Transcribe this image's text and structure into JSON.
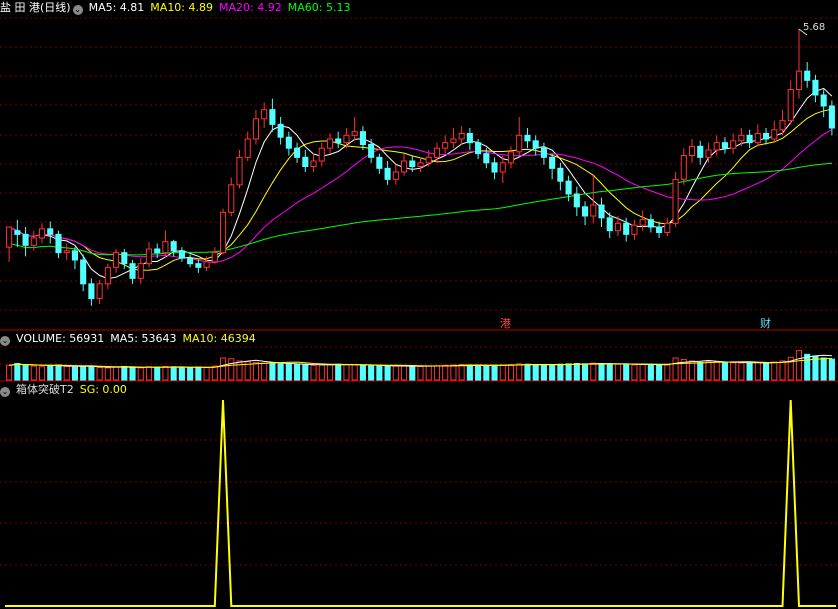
{
  "price_legend": {
    "title": "盐 田 港(日线)",
    "ma5": "MA5: 4.81",
    "ma10": "MA10: 4.89",
    "ma20": "MA20: 4.92",
    "ma60": "MA60: 5.13"
  },
  "volume_legend": {
    "title": "VOLUME: 56931",
    "ma5": "MA5: 53643",
    "ma10": "MA10: 46394"
  },
  "indicator_legend": {
    "title": "箱体突破T2",
    "sg": "SG: 0.00"
  },
  "markers": {
    "gang": "港",
    "cai": "财",
    "high_value": "5.68"
  },
  "colors": {
    "up": "#ff3232",
    "down": "#54ffff",
    "ma5": "#ffffff",
    "ma10": "#ffff00",
    "ma20": "#ff00ff",
    "ma60": "#00ff00",
    "sg": "#ffff00",
    "grid": "#7a0000",
    "divider": "#b40000"
  },
  "chart_data": {
    "type": "candlestick",
    "highest_label": 5.68,
    "sg_signal_bar_indices": [
      26,
      95
    ],
    "ohlc": [
      [
        4.49,
        4.6,
        4.58,
        4.41
      ],
      [
        4.58,
        4.56,
        4.64,
        4.49
      ],
      [
        4.56,
        4.5,
        4.6,
        4.44
      ],
      [
        4.5,
        4.54,
        4.58,
        4.47
      ],
      [
        4.54,
        4.59,
        4.62,
        4.51
      ],
      [
        4.59,
        4.56,
        4.63,
        4.51
      ],
      [
        4.56,
        4.46,
        4.58,
        4.43
      ],
      [
        4.46,
        4.47,
        4.51,
        4.42
      ],
      [
        4.47,
        4.42,
        4.49,
        4.37
      ],
      [
        4.42,
        4.29,
        4.45,
        4.25
      ],
      [
        4.29,
        4.21,
        4.32,
        4.17
      ],
      [
        4.21,
        4.29,
        4.31,
        4.18
      ],
      [
        4.29,
        4.38,
        4.4,
        4.26
      ],
      [
        4.38,
        4.46,
        4.48,
        4.35
      ],
      [
        4.46,
        4.4,
        4.48,
        4.37
      ],
      [
        4.4,
        4.32,
        4.42,
        4.29
      ],
      [
        4.32,
        4.4,
        4.43,
        4.29
      ],
      [
        4.4,
        4.48,
        4.52,
        4.38
      ],
      [
        4.48,
        4.46,
        4.51,
        4.43
      ],
      [
        4.46,
        4.52,
        4.58,
        4.43
      ],
      [
        4.52,
        4.47,
        4.53,
        4.44
      ],
      [
        4.47,
        4.43,
        4.49,
        4.41
      ],
      [
        4.43,
        4.4,
        4.45,
        4.38
      ],
      [
        4.4,
        4.38,
        4.42,
        4.35
      ],
      [
        4.38,
        4.41,
        4.44,
        4.36
      ],
      [
        4.41,
        4.46,
        4.49,
        4.4
      ],
      [
        4.46,
        4.68,
        4.7,
        4.45
      ],
      [
        4.68,
        4.83,
        4.87,
        4.66
      ],
      [
        4.83,
        4.98,
        5.02,
        4.81
      ],
      [
        4.98,
        5.08,
        5.12,
        4.96
      ],
      [
        5.08,
        5.19,
        5.24,
        5.05
      ],
      [
        5.19,
        5.24,
        5.28,
        5.14
      ],
      [
        5.24,
        5.16,
        5.3,
        5.12
      ],
      [
        5.16,
        5.09,
        5.2,
        5.05
      ],
      [
        5.09,
        5.03,
        5.12,
        4.99
      ],
      [
        5.03,
        4.98,
        5.06,
        4.95
      ],
      [
        4.98,
        4.93,
        5.02,
        4.9
      ],
      [
        4.93,
        4.96,
        5.0,
        4.9
      ],
      [
        4.96,
        5.03,
        5.06,
        4.93
      ],
      [
        5.03,
        5.08,
        5.11,
        5.0
      ],
      [
        5.08,
        5.06,
        5.12,
        5.03
      ],
      [
        5.06,
        5.1,
        5.14,
        5.03
      ],
      [
        5.1,
        5.12,
        5.2,
        5.07
      ],
      [
        5.12,
        5.05,
        5.15,
        5.02
      ],
      [
        5.05,
        4.98,
        5.08,
        4.95
      ],
      [
        4.98,
        4.92,
        5.0,
        4.89
      ],
      [
        4.92,
        4.86,
        4.96,
        4.83
      ],
      [
        4.86,
        4.9,
        4.94,
        4.83
      ],
      [
        4.9,
        4.96,
        5.0,
        4.88
      ],
      [
        4.96,
        4.93,
        4.99,
        4.9
      ],
      [
        4.93,
        4.95,
        4.98,
        4.9
      ],
      [
        4.95,
        4.98,
        5.02,
        4.93
      ],
      [
        4.98,
        5.03,
        5.06,
        4.95
      ],
      [
        5.03,
        5.06,
        5.1,
        5.0
      ],
      [
        5.06,
        5.08,
        5.14,
        5.03
      ],
      [
        5.08,
        5.11,
        5.15,
        5.05
      ],
      [
        5.11,
        5.06,
        5.14,
        5.02
      ],
      [
        5.06,
        5.0,
        5.08,
        4.97
      ],
      [
        5.0,
        4.95,
        5.03,
        4.92
      ],
      [
        4.95,
        4.9,
        4.98,
        4.86
      ],
      [
        4.9,
        4.95,
        4.99,
        4.84
      ],
      [
        4.95,
        5.01,
        5.04,
        4.92
      ],
      [
        5.01,
        5.1,
        5.2,
        4.99
      ],
      [
        5.1,
        5.07,
        5.14,
        5.03
      ],
      [
        5.07,
        5.03,
        5.1,
        4.99
      ],
      [
        5.03,
        4.98,
        5.06,
        4.94
      ],
      [
        4.98,
        4.92,
        5.0,
        4.86
      ],
      [
        4.92,
        4.85,
        4.95,
        4.8
      ],
      [
        4.85,
        4.78,
        4.88,
        4.74
      ],
      [
        4.78,
        4.71,
        4.82,
        4.66
      ],
      [
        4.71,
        4.66,
        4.74,
        4.61
      ],
      [
        4.66,
        4.72,
        4.88,
        4.62
      ],
      [
        4.72,
        4.65,
        4.76,
        4.6
      ],
      [
        4.65,
        4.58,
        4.68,
        4.54
      ],
      [
        4.58,
        4.62,
        4.66,
        4.55
      ],
      [
        4.62,
        4.56,
        4.65,
        4.52
      ],
      [
        4.56,
        4.61,
        4.64,
        4.53
      ],
      [
        4.61,
        4.64,
        4.69,
        4.58
      ],
      [
        4.64,
        4.6,
        4.67,
        4.57
      ],
      [
        4.6,
        4.57,
        4.63,
        4.54
      ],
      [
        4.57,
        4.62,
        4.65,
        4.55
      ],
      [
        4.62,
        4.86,
        4.9,
        4.6
      ],
      [
        4.86,
        4.99,
        5.03,
        4.83
      ],
      [
        4.99,
        5.04,
        5.08,
        4.95
      ],
      [
        5.04,
        4.98,
        5.07,
        4.94
      ],
      [
        4.98,
        5.02,
        5.06,
        4.95
      ],
      [
        5.02,
        5.06,
        5.1,
        4.99
      ],
      [
        5.06,
        5.03,
        5.09,
        5.0
      ],
      [
        5.03,
        5.07,
        5.11,
        5.0
      ],
      [
        5.07,
        5.1,
        5.14,
        5.04
      ],
      [
        5.1,
        5.06,
        5.13,
        5.03
      ],
      [
        5.06,
        5.11,
        5.16,
        5.04
      ],
      [
        5.11,
        5.08,
        5.14,
        5.05
      ],
      [
        5.08,
        5.13,
        5.18,
        5.06
      ],
      [
        5.13,
        5.18,
        5.24,
        5.1
      ],
      [
        5.18,
        5.35,
        5.4,
        5.16
      ],
      [
        5.35,
        5.45,
        5.68,
        5.3
      ],
      [
        5.45,
        5.4,
        5.5,
        5.36
      ],
      [
        5.4,
        5.32,
        5.43,
        5.28
      ],
      [
        5.32,
        5.26,
        5.35,
        5.2
      ],
      [
        5.26,
        5.14,
        5.29,
        5.1
      ]
    ],
    "volume": [
      40000,
      45000,
      42000,
      38000,
      36000,
      39000,
      41000,
      37000,
      35000,
      36000,
      38000,
      34000,
      33000,
      35000,
      37000,
      34000,
      33000,
      36000,
      35000,
      37000,
      36000,
      34000,
      33000,
      35000,
      34000,
      38000,
      60000,
      58000,
      52000,
      50000,
      48000,
      46000,
      45000,
      44000,
      43000,
      42000,
      41000,
      40000,
      41000,
      42000,
      43000,
      42000,
      41000,
      40000,
      39000,
      38000,
      37000,
      38000,
      39000,
      38000,
      37000,
      38000,
      39000,
      40000,
      41000,
      42000,
      41000,
      40000,
      39000,
      40000,
      41000,
      42000,
      44000,
      43000,
      42000,
      41000,
      42000,
      43000,
      44000,
      45000,
      44000,
      46000,
      45000,
      44000,
      43000,
      42000,
      41000,
      42000,
      43000,
      42000,
      41000,
      60000,
      56000,
      52000,
      48000,
      50000,
      49000,
      48000,
      47000,
      46000,
      45000,
      48000,
      47000,
      49000,
      52000,
      62000,
      80000,
      70000,
      65000,
      60000,
      56931
    ]
  }
}
